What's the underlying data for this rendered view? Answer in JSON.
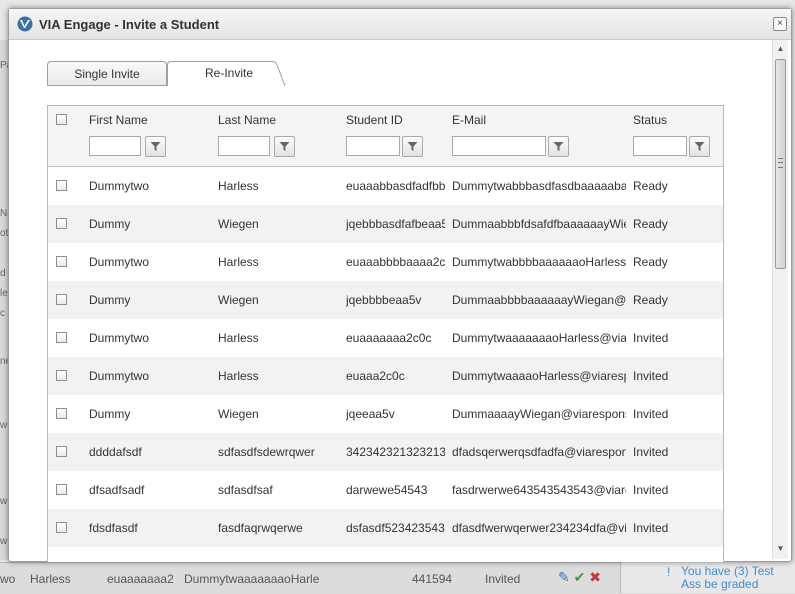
{
  "dialog": {
    "title": "VIA Engage - Invite a Student",
    "close_label": "×"
  },
  "tabs": [
    {
      "label": "Single Invite",
      "active": false
    },
    {
      "label": "Re-Invite",
      "active": true
    }
  ],
  "grid": {
    "columns": [
      "First Name",
      "Last Name",
      "Student ID",
      "E-Mail",
      "Status"
    ],
    "rows": [
      {
        "first": "Dummytwo",
        "last": "Harless",
        "id": "euaaabbasdfadfbb",
        "email": "Dummytwabbbasdfasdbaaaaaba",
        "status": "Ready"
      },
      {
        "first": "Dummy",
        "last": "Wiegen",
        "id": "jqebbbasdfafbeaa5",
        "email": "DummaabbbfdsafdfbaaaaaayWie",
        "status": "Ready"
      },
      {
        "first": "Dummytwo",
        "last": "Harless",
        "id": "euaaabbbbaaaa2c0",
        "email": "DummytwabbbbaaaaaaoHarless(",
        "status": "Ready"
      },
      {
        "first": "Dummy",
        "last": "Wiegen",
        "id": "jqebbbbeaa5v",
        "email": "DummaabbbbaaaaaayWiegan@v",
        "status": "Ready"
      },
      {
        "first": "Dummytwo",
        "last": "Harless",
        "id": "euaaaaaaa2c0c",
        "email": "DummytwaaaaaaaoHarless@viar",
        "status": "Invited"
      },
      {
        "first": "Dummytwo",
        "last": "Harless",
        "id": "euaaa2c0c",
        "email": "DummytwaaaaoHarless@viaresp",
        "status": "Invited"
      },
      {
        "first": "Dummy",
        "last": "Wiegen",
        "id": "jqeeaa5v",
        "email": "DummaaaayWiegan@viarespons",
        "status": "Invited"
      },
      {
        "first": "ddddafsdf",
        "last": "sdfasdfsdewrqwer",
        "id": "34234232132321324",
        "email": "dfadsqerwerqsdfadfa@viarespon",
        "status": "Invited"
      },
      {
        "first": "dfsadfsadf",
        "last": "sdfasdfsaf",
        "id": "darwewe54543",
        "email": "fasdrwerwe643543543543@viares",
        "status": "Invited"
      },
      {
        "first": "fdsdfasdf",
        "last": "fasdfaqrwqerwe",
        "id": "dsfasdf5234235435",
        "email": "dfasdfwerwqerwer234234dfa@via",
        "status": "Invited"
      }
    ]
  },
  "background": {
    "row_first": "wo",
    "row_last": "Harless",
    "row_id": "euaaaaaaa2",
    "row_email": "DummytwaaaaaaaoHarle",
    "row_number": "441594",
    "row_status": "Invited",
    "notice": "You have (3) Test Ass be graded",
    "left_fragments": [
      "Pa",
      "Na",
      "ot",
      "d",
      "le",
      "c",
      "ne",
      "w",
      "w",
      "w"
    ]
  },
  "colors": {
    "accent": "#3e8ed0",
    "row_alt": "#f2f2f2",
    "header_bg": "#f4f4f4"
  }
}
